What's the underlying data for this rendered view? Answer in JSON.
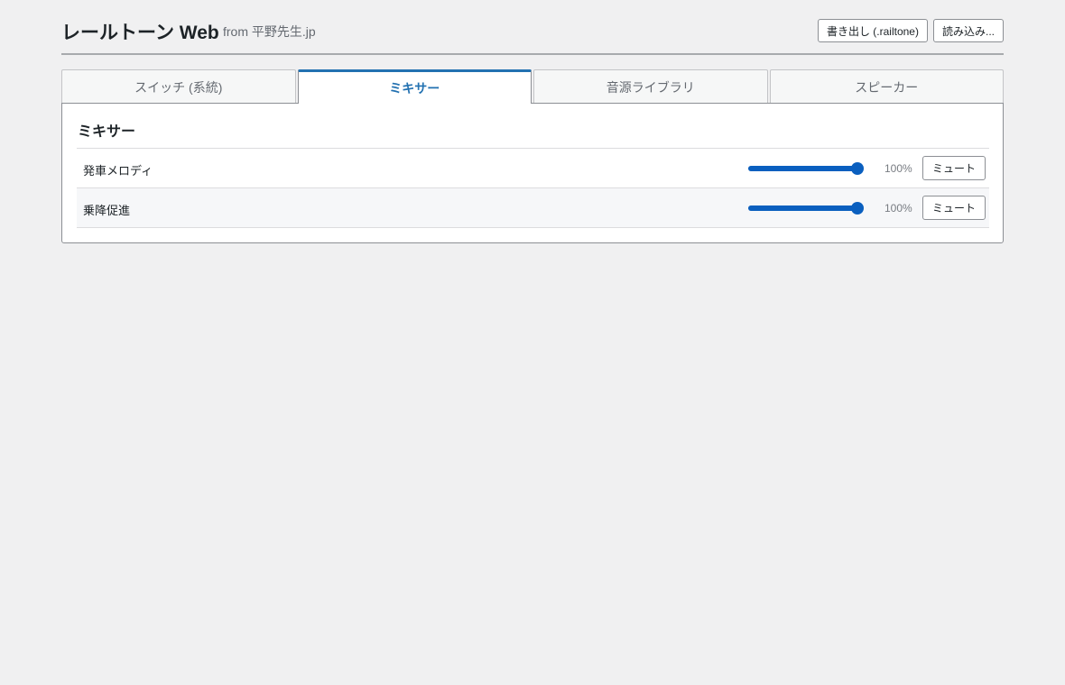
{
  "header": {
    "title": "レールトーン Web",
    "subtitle": "from 平野先生.jp",
    "export_label": "書き出し (.railtone)",
    "import_label": "読み込み..."
  },
  "tabs": [
    {
      "label": "スイッチ (系統)",
      "active": false
    },
    {
      "label": "ミキサー",
      "active": true
    },
    {
      "label": "音源ライブラリ",
      "active": false
    },
    {
      "label": "スピーカー",
      "active": false
    }
  ],
  "mixer": {
    "title": "ミキサー",
    "channels": [
      {
        "name": "発車メロディ",
        "volume": 100,
        "volume_label": "100%",
        "mute_label": "ミュート"
      },
      {
        "name": "乗降促進",
        "volume": 100,
        "volume_label": "100%",
        "mute_label": "ミュート"
      }
    ]
  },
  "colors": {
    "accent": "#2271b1",
    "slider": "#0a5fbf",
    "background": "#f0f0f1"
  }
}
